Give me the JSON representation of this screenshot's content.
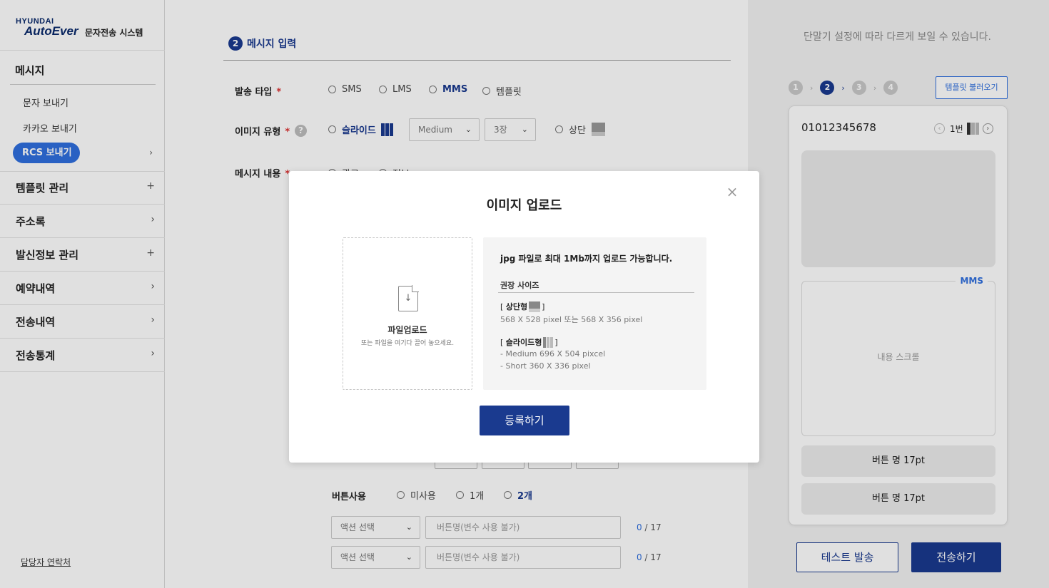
{
  "logo": {
    "brand_small": "HYUNDAI",
    "brand": "AutoEver",
    "system_name": "문자전송 시스템"
  },
  "sidebar": {
    "section_title": "메시지",
    "sub_items": [
      {
        "label": "문자 보내기"
      },
      {
        "label": "카카오 보내기"
      },
      {
        "label": "RCS 보내기",
        "active": true
      }
    ],
    "menus": [
      {
        "label": "템플릿 관리",
        "indicator": "+"
      },
      {
        "label": "주소록",
        "indicator": "›"
      },
      {
        "label": "발신정보 관리",
        "indicator": "+"
      },
      {
        "label": "예약내역",
        "indicator": "›"
      },
      {
        "label": "전송내역",
        "indicator": "›"
      },
      {
        "label": "전송통계",
        "indicator": "›"
      }
    ],
    "contact_link": "담당자 연락처"
  },
  "main": {
    "step_number": "2",
    "step_title": "메시지 입력",
    "send_type": {
      "label": "발송 타입",
      "required": "*",
      "options": [
        "SMS",
        "LMS",
        "MMS",
        "템플릿"
      ],
      "selected": "MMS"
    },
    "image_type": {
      "label": "이미지 유형",
      "required": "*",
      "help_icon": "?",
      "option_slide": "슬라이드",
      "size_select": "Medium",
      "count_select": "3장",
      "option_top": "상단"
    },
    "message_content": {
      "label": "메시지 내용",
      "required": "*",
      "options": [
        "광고",
        "정보"
      ]
    },
    "button_use": {
      "label": "버튼사용",
      "options": [
        "미사용",
        "1개",
        "2개"
      ],
      "selected": "2개"
    },
    "button_rows": [
      {
        "action_placeholder": "액션 선택",
        "name_placeholder": "버튼명(변수 사용 불가)",
        "count": "0",
        "max": "/ 17"
      },
      {
        "action_placeholder": "액션 선택",
        "name_placeholder": "버튼명(변수 사용 불가)",
        "count": "0",
        "max": "/ 17"
      }
    ]
  },
  "preview": {
    "notice": "단말기 설정에 따라 다르게 보일 수 있습니다.",
    "steps": [
      "1",
      "2",
      "3",
      "4"
    ],
    "active_step": "2",
    "template_load_button": "템플릿 불러오기",
    "phone_number": "01012345678",
    "slide_indicator": "1번",
    "mms_label": "MMS",
    "scroll_text": "내용 스크롤",
    "buttons": [
      "버튼 명 17pt",
      "버튼 명 17pt"
    ],
    "test_send_button": "테스트 발송",
    "send_button": "전송하기"
  },
  "modal": {
    "title": "이미지 업로드",
    "close_icon": "×",
    "upload_title": "파일업로드",
    "upload_hint": "또는 파일을 여기다 끌어 놓으세요.",
    "main_info": "jpg 파일로 최대 1Mb까지 업로드 가능합니다.",
    "recommend_head": "권장 사이즈",
    "top_type_label": "상단형",
    "top_type_size": "568 X 528 pixel 또는 568 X 356 pixel",
    "slide_type_label": "슬라이드형",
    "slide_medium": "- Medium 696 X 504 pixcel",
    "slide_short": "- Short 360 X 336 pixel",
    "submit_button": "등록하기"
  },
  "colors": {
    "primary": "#1a3a8f",
    "accent": "#2f6fde",
    "overlay": "rgba(0,0,0,0.12)"
  }
}
